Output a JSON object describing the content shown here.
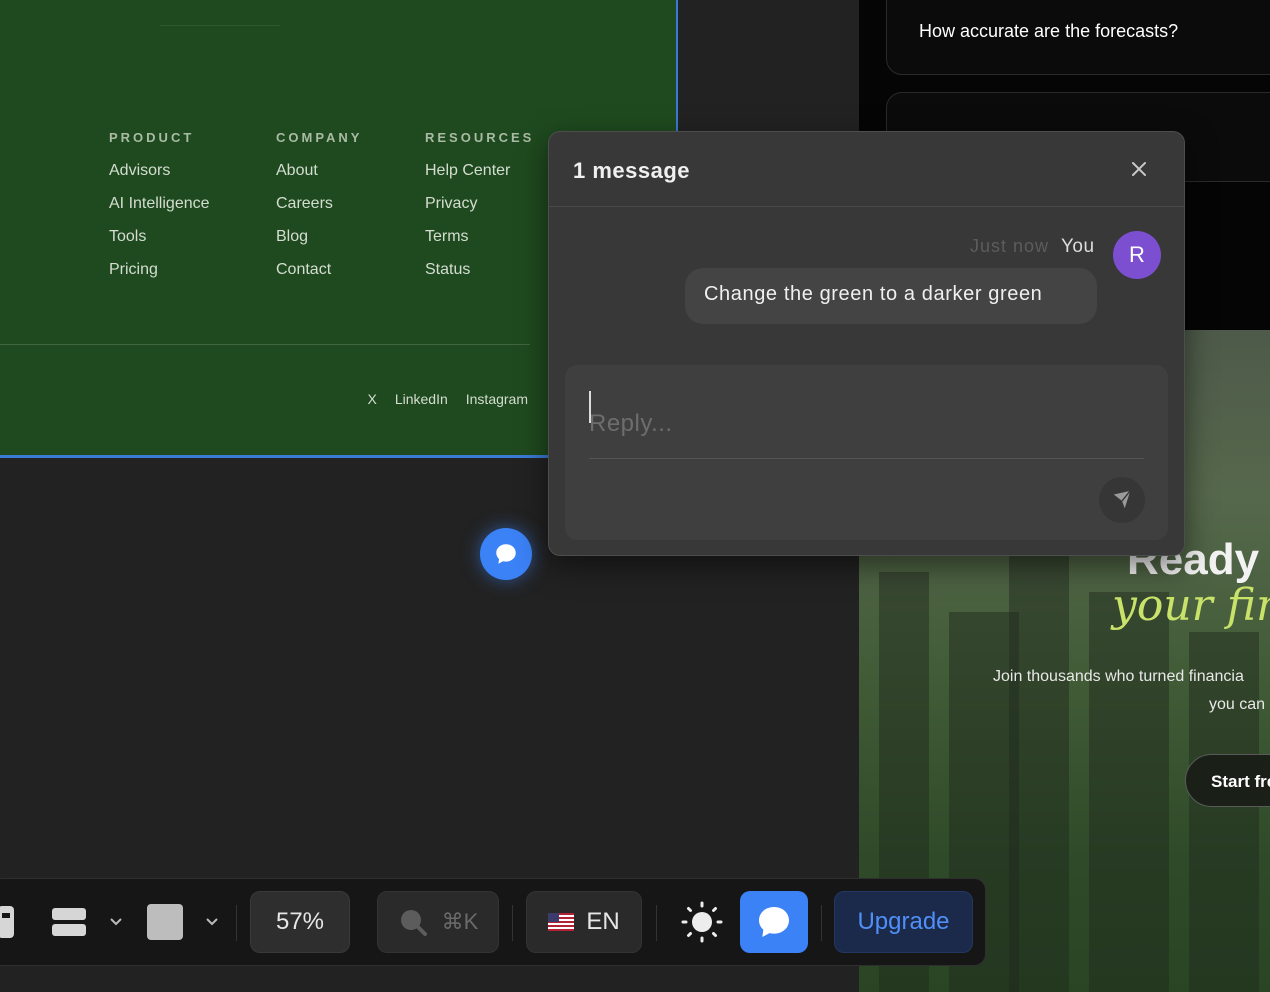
{
  "footer": {
    "columns": [
      {
        "heading": "PRODUCT",
        "links": [
          "Advisors",
          "AI Intelligence",
          "Tools",
          "Pricing"
        ]
      },
      {
        "heading": "COMPANY",
        "links": [
          "About",
          "Careers",
          "Blog",
          "Contact"
        ]
      },
      {
        "heading": "RESOURCES",
        "links": [
          "Help Center",
          "Privacy",
          "Terms",
          "Status"
        ]
      }
    ],
    "social": [
      "X",
      "LinkedIn",
      "Instagram"
    ]
  },
  "faq": {
    "question": "How accurate are the forecasts?"
  },
  "hero": {
    "title": "Ready t",
    "italic": "your fin",
    "sub_line1": "Join thousands who turned financia",
    "sub_line2": "you can",
    "cta": "Start fre"
  },
  "popover": {
    "title": "1 message",
    "message": {
      "time": "Just now",
      "author": "You",
      "avatar_initial": "R",
      "text": "Change the green to a darker green"
    },
    "reply_placeholder": "Reply..."
  },
  "toolbar": {
    "zoom": "57%",
    "search_shortcut": "⌘K",
    "language": "EN",
    "upgrade_label": "Upgrade"
  },
  "colors": {
    "accent": "#3b82f6",
    "footer_green": "#1f4a1f",
    "avatar": "#7c4fd1"
  }
}
